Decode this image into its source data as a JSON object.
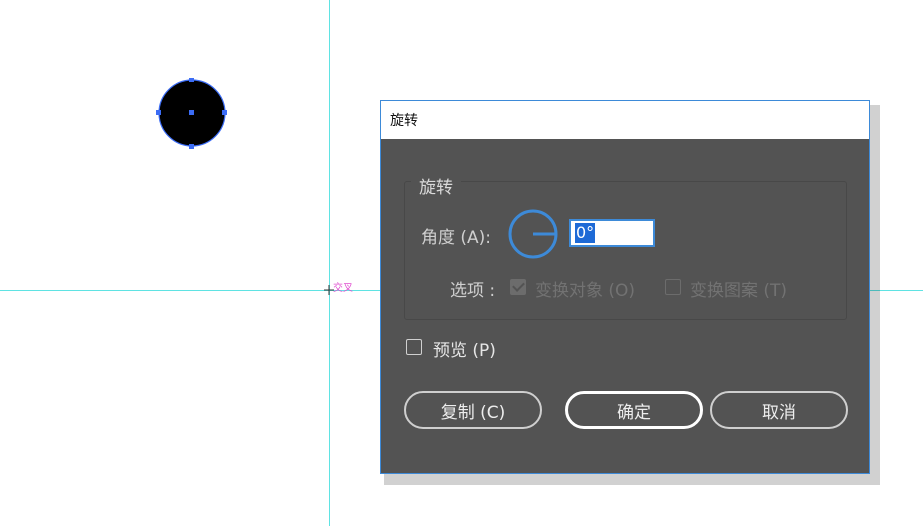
{
  "canvas": {
    "intersect_label": "交叉"
  },
  "dialog": {
    "title": "旋转",
    "group_label": "旋转",
    "angle_label": "角度 (A):",
    "angle_value": "0°",
    "options_label": "选项 :",
    "transform_objects": {
      "label": "变换对象 (O)",
      "checked": true,
      "enabled": false
    },
    "transform_patterns": {
      "label": "变换图案 (T)",
      "checked": false,
      "enabled": false
    },
    "preview": {
      "label": "预览 (P)",
      "checked": false
    },
    "buttons": {
      "copy": "复制 (C)",
      "ok": "确定",
      "cancel": "取消"
    }
  },
  "colors": {
    "guide": "#5fe3e3",
    "dialog_bg": "#535353",
    "accent": "#3d8ad8",
    "selection": "#3b6cf5"
  },
  "icons": [
    "angle-dial-icon",
    "crosshair-icon",
    "checkbox-icon"
  ]
}
